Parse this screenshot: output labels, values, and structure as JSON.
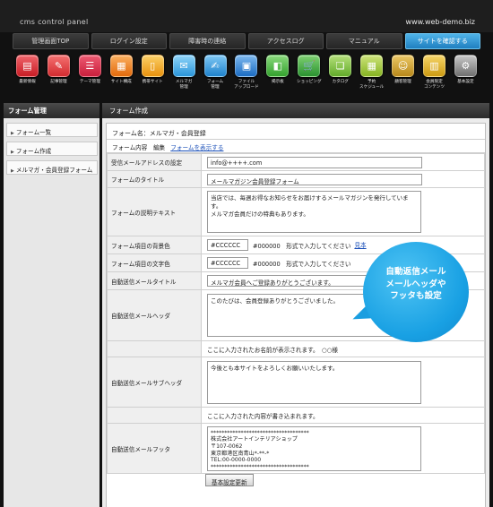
{
  "header": {
    "app_title": "cms control panel",
    "site_url": "www.web-demo.biz"
  },
  "nav": {
    "tabs": [
      {
        "label": "管理画面TOP",
        "active": false
      },
      {
        "label": "ログイン設定",
        "active": false
      },
      {
        "label": "障害時の連絡",
        "active": false
      },
      {
        "label": "アクセスログ",
        "active": false
      },
      {
        "label": "マニュアル",
        "active": false
      },
      {
        "label": "サイトを確認する",
        "active": true
      }
    ]
  },
  "iconbar": {
    "items": [
      {
        "label": "最新情報",
        "icon": "news-icon",
        "color": "#d8262e"
      },
      {
        "label": "記事管理",
        "icon": "article-icon",
        "color": "#e23c3c"
      },
      {
        "label": "テーマ管理",
        "icon": "theme-icon",
        "color": "#d92b45"
      },
      {
        "label": "サイト構成",
        "icon": "site-structure-icon",
        "color": "#ef7b1a"
      },
      {
        "label": "携帯サイト",
        "icon": "mobile-site-icon",
        "color": "#f0a21c"
      },
      {
        "label": "メルマガ\n管理",
        "icon": "newsletter-icon",
        "color": "#36a3e0"
      },
      {
        "label": "フォーム\n管理",
        "icon": "form-icon",
        "color": "#2b8fd6"
      },
      {
        "label": "ファイル\nアップロード",
        "icon": "file-upload-icon",
        "color": "#2a7fd0"
      },
      {
        "label": "掲示板",
        "icon": "bbs-icon",
        "color": "#4cb848"
      },
      {
        "label": "ショッピング",
        "icon": "shopping-icon",
        "color": "#3aa640"
      },
      {
        "label": "カタログ",
        "icon": "catalog-icon",
        "color": "#7ac142"
      },
      {
        "label": "予約\nスケジュール",
        "icon": "reservation-icon",
        "color": "#9cc83a"
      },
      {
        "label": "顧客管理",
        "icon": "customer-icon",
        "color": "#c8a02a"
      },
      {
        "label": "会員限定\nコンテンツ",
        "icon": "members-icon",
        "color": "#e0b020"
      },
      {
        "label": "基本設定",
        "icon": "settings-icon",
        "color": "#8c8c8c"
      }
    ]
  },
  "sidebar": {
    "heading": "フォーム管理",
    "items": [
      {
        "label": "フォーム一覧"
      },
      {
        "label": "フォーム作成"
      },
      {
        "label": "メルマガ・会員登録フォーム"
      }
    ]
  },
  "main": {
    "heading": "フォーム作成",
    "form_name": "フォーム名：メルマガ・会員登録",
    "content_edit": "フォーム内容　編集",
    "show_form_link": "フォームを表示する",
    "rows": {
      "reply_address": {
        "label": "受信メールアドレスの設定",
        "value": "info@++++.com"
      },
      "form_title": {
        "label": "フォームのタイトル",
        "value": "メールマガジン会員登録フォーム"
      },
      "description": {
        "label": "フォームの説明テキスト",
        "value": "当店では、毎週お得なお知らせをお届けするメールマガジンを発行しています。\nメルマガ会員だけの特典もあります。"
      },
      "bg_color": {
        "label": "フォーム項目の背景色",
        "value": "#CCCCCC",
        "hint": "#000000　形式で入力してください",
        "preview_link": "見本"
      },
      "text_color": {
        "label": "フォーム項目の文字色",
        "value": "#CCCCCC",
        "hint": "#000000　形式で入力してください"
      },
      "auto_title": {
        "label": "自動送信メールタイトル",
        "value": "メルマガ会員へご登録ありがとうございます。"
      },
      "auto_header": {
        "label": "自動送信メールヘッダ",
        "value": "このたびは、会員登録ありがとうございました。"
      },
      "name_note": "ここに入力されたお名前が表示されます。　○○様",
      "auto_subheader": {
        "label": "自動送信メールサブヘッダ",
        "value": "今後とも本サイトをよろしくお願いいたします。"
      },
      "content_note": "ここに入力された内容が書き込まれます。",
      "auto_footer": {
        "label": "自動送信メールフッタ",
        "value": "************************************\n株式会社アートインテリアショップ\n〒107-0062\n東京都港区南青山*-**-*\nTEL:00-0000-0000\n************************************"
      }
    },
    "submit_label": "基本設定更新"
  },
  "callout": {
    "line1": "自動返信メール",
    "line2": "メールヘッダや",
    "line3": "フッタも設定",
    "color": "#18a0e3"
  }
}
